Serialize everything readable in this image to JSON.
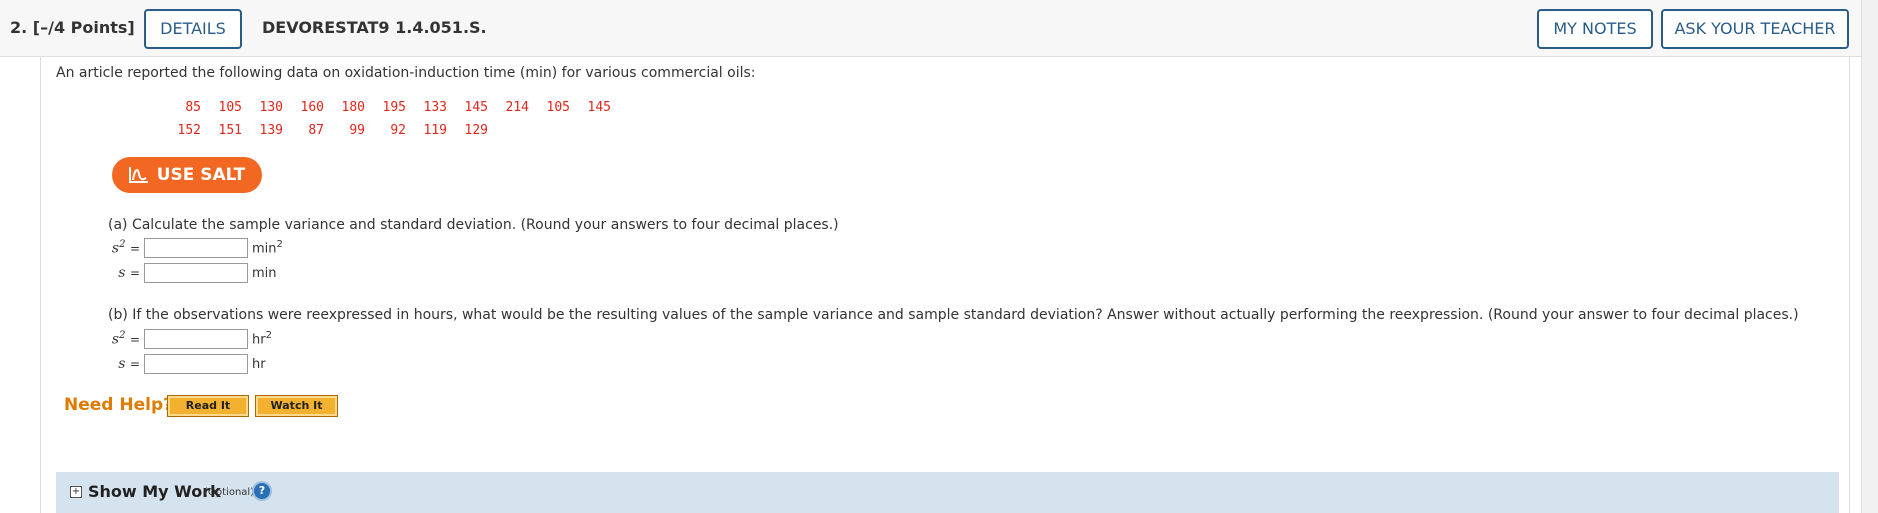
{
  "header": {
    "question_number": "2.",
    "points": "[–/4 Points]",
    "details_label": "DETAILS",
    "question_code": "DEVORESTAT9 1.4.051.S.",
    "my_notes_label": "MY NOTES",
    "ask_teacher_label": "ASK YOUR TEACHER"
  },
  "intro": "An article reported the following data on oxidation-induction time (min) for various commercial oils:",
  "data_rows": [
    [
      "85",
      "105",
      "130",
      "160",
      "180",
      "195",
      "133",
      "145",
      "214",
      "105",
      "145"
    ],
    [
      "152",
      "151",
      "139",
      "87",
      "99",
      "92",
      "119",
      "129"
    ]
  ],
  "salt_label": "USE SALT",
  "part_a": {
    "text": "(a) Calculate the sample variance and standard deviation. (Round your answers to four decimal places.)",
    "s2_label": "s",
    "s2_sup": "2",
    "eq": "=",
    "s2_unit": "min",
    "s2_unit_sup": "2",
    "s_label": "s",
    "s_unit": "min",
    "s2_value": "",
    "s_value": ""
  },
  "part_b": {
    "text": "(b) If the observations were reexpressed in hours, what would be the resulting values of the sample variance and sample standard deviation? Answer without actually performing the reexpression. (Round your answer to four decimal places.)",
    "s2_label": "s",
    "s2_sup": "2",
    "eq": "=",
    "s2_unit": "hr",
    "s2_unit_sup": "2",
    "s_label": "s",
    "s_unit": "hr",
    "s2_value": "",
    "s_value": ""
  },
  "help": {
    "need_help": "Need Help?",
    "read_it": "Read It",
    "watch_it": "Watch It"
  },
  "show_work": {
    "label": "Show My Work",
    "optional": "(Optional)",
    "help_glyph": "?"
  },
  "icons": {
    "salt": "chart-icon",
    "expand": "plus-box-icon",
    "help": "help-circle-icon"
  },
  "colors": {
    "accent_blue": "#2a5c8a",
    "salt_orange": "#f26722",
    "data_red": "#e0261b",
    "need_help_orange": "#e07b00",
    "showwork_bg": "#d5e3ee"
  }
}
